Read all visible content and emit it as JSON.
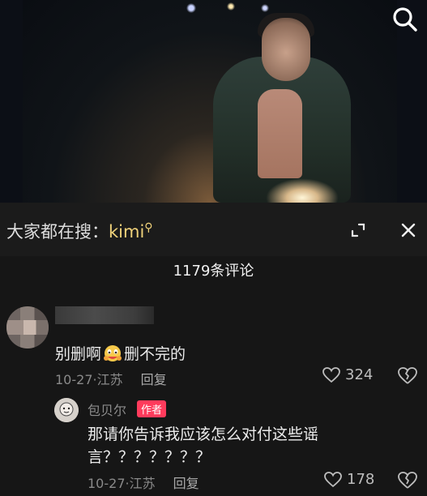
{
  "video": {
    "description_icon": "search-icon"
  },
  "search": {
    "prompt": "大家都在搜：",
    "keyword": "kimi",
    "keyword_icon": "search-magnifier-icon"
  },
  "panel": {
    "comment_count_label": "1179条评论"
  },
  "comments": [
    {
      "text_before": "别删啊",
      "emoji": "crying-hug-emoji",
      "text_after": "删不完的",
      "date": "10-27",
      "location": "江苏",
      "reply_label": "回复",
      "likes": "324"
    }
  ],
  "reply": {
    "author": "包贝尔",
    "badge": "作者",
    "text_line1": "那请你告诉我应该怎么对付这些谣",
    "text_line2": "言？？？？？？？",
    "date": "10-27",
    "location": "江苏",
    "reply_label": "回复",
    "likes": "178"
  },
  "colors": {
    "background": "#161616",
    "keyword": "#f0d27a",
    "author_badge": "#ff3b5c"
  }
}
